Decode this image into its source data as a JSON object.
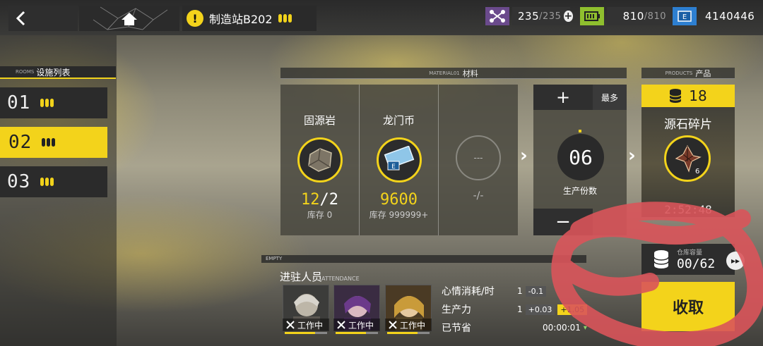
{
  "topbar": {
    "station_name": "制造站B202",
    "resources": [
      {
        "icon": "drone-icon",
        "current": "235",
        "max": "/235"
      },
      {
        "icon": "battery-icon",
        "current": "810",
        "max": "/810"
      },
      {
        "icon": "lmd-icon",
        "current": "4140446",
        "max": ""
      }
    ]
  },
  "sidebar": {
    "header_en": "ROOMS",
    "header_zh": "设施列表",
    "rooms": [
      {
        "label": "01",
        "selected": false
      },
      {
        "label": "02",
        "selected": true
      },
      {
        "label": "03",
        "selected": false
      }
    ]
  },
  "material": {
    "header_en": "MATERIAL01",
    "header_zh": "材料",
    "items": [
      {
        "name": "固源岩",
        "have": "12",
        "need": "/2",
        "stock": "库存 0"
      },
      {
        "name": "龙门币",
        "have": "9600",
        "need": "",
        "stock": "库存 999999+"
      }
    ],
    "empty_circle": "---",
    "empty_count": "-/-"
  },
  "count": {
    "plus": "+",
    "max": "最多",
    "value": "06",
    "label": "生产份数",
    "minus": "−"
  },
  "products": {
    "header_en": "PRODUCTS",
    "header_zh": "产品",
    "amount": "18",
    "name": "源石碎片",
    "badge": "6",
    "time": "2:52:48",
    "capacity_label": "仓库容量",
    "capacity_value": "00/62",
    "collect": "收取"
  },
  "attendance": {
    "empty_label": "EMPTY",
    "label": "进驻人员",
    "label_en": "ATTENDANCE",
    "operators": [
      {
        "status": "工作中"
      },
      {
        "status": "工作中"
      },
      {
        "status": "工作中"
      }
    ]
  },
  "stats": {
    "mood_label": "心情消耗/时",
    "mood_base": "1",
    "mood_delta": "-0.1",
    "prod_label": "生产力",
    "prod_base": "1",
    "prod_delta1": "+0.03",
    "prod_delta2": "+1.05",
    "saved_label": "已节省",
    "saved_value": "00:00:01"
  },
  "colors": {
    "accent": "#f3d31b",
    "scribble": "#d9545a"
  }
}
